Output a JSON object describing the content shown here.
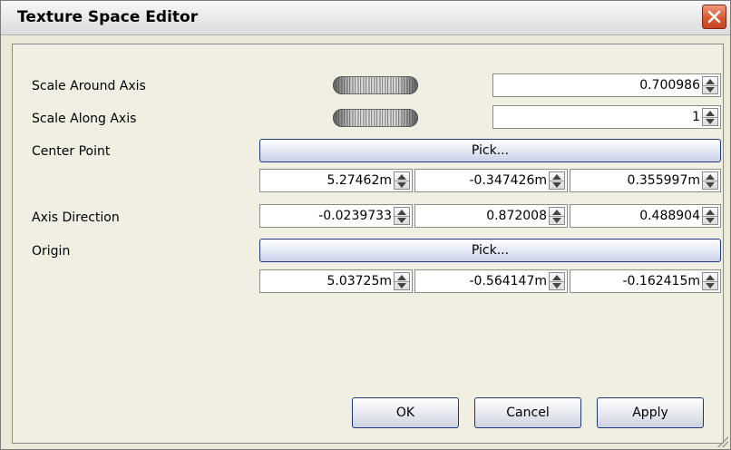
{
  "window": {
    "title": "Texture Space Editor"
  },
  "rows": {
    "scale_around_axis": {
      "label": "Scale Around Axis",
      "value": "0.700986"
    },
    "scale_along_axis": {
      "label": "Scale Along Axis",
      "value": "1"
    },
    "center_point": {
      "label": "Center Point",
      "pick_label": "Pick...",
      "x": "5.27462m",
      "y": "-0.347426m",
      "z": "0.355997m"
    },
    "axis_direction": {
      "label": "Axis Direction",
      "x": "-0.0239733",
      "y": "0.872008",
      "z": "0.488904"
    },
    "origin": {
      "label": "Origin",
      "pick_label": "Pick...",
      "x": "5.03725m",
      "y": "-0.564147m",
      "z": "-0.162415m"
    }
  },
  "buttons": {
    "ok": "OK",
    "cancel": "Cancel",
    "apply": "Apply"
  },
  "icons": {
    "close": "close-icon",
    "spinner": "spinner-arrows-icon",
    "jog": "jog-wheel-icon"
  },
  "colors": {
    "close_button": "#d9582f",
    "button_border": "#1c3a7a"
  }
}
